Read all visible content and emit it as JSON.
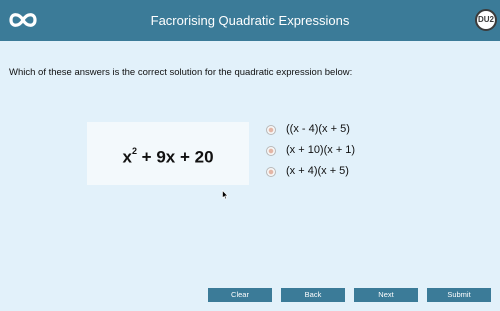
{
  "header": {
    "title": "Facrorising Quadratic Expressions",
    "logo_icon": "infinity-icon",
    "badge_text": "DU2"
  },
  "question": {
    "text": "Which of these answers is the correct solution for the quadratic expression below:"
  },
  "expression": {
    "base": "x",
    "exponent": "2",
    "rest": " + 9x + 20"
  },
  "options": [
    {
      "label": "((x - 4)(x + 5)"
    },
    {
      "label": "(x + 10)(x + 1)"
    },
    {
      "label": "(x + 4)(x + 5)"
    }
  ],
  "buttons": {
    "clear": "Clear",
    "back": "Back",
    "next": "Next",
    "submit": "Submit"
  },
  "colors": {
    "header": "#3b7b98",
    "background": "#e2f1fa",
    "button": "#3b7b98"
  }
}
